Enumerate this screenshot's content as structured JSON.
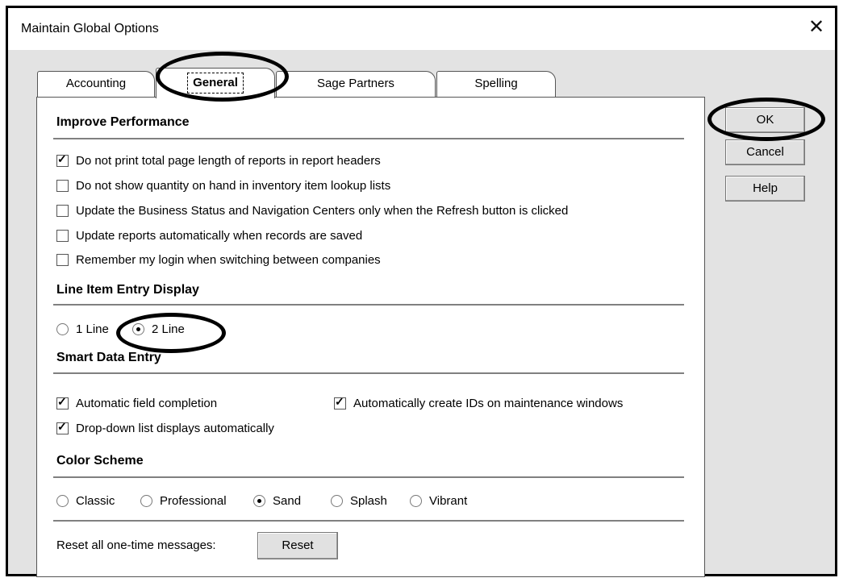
{
  "window": {
    "title": "Maintain Global Options",
    "close_glyph": "✕"
  },
  "tabs": [
    {
      "label": "Accounting",
      "active": false
    },
    {
      "label": "General",
      "active": true
    },
    {
      "label": "Sage Partners",
      "active": false
    },
    {
      "label": "Spelling",
      "active": false
    }
  ],
  "buttons": {
    "ok": "OK",
    "cancel": "Cancel",
    "help": "Help"
  },
  "improve_performance": {
    "heading": "Improve Performance",
    "options": [
      {
        "label": "Do not print total page length of reports in report headers",
        "checked": true
      },
      {
        "label": "Do not show quantity on hand in inventory item lookup lists",
        "checked": false
      },
      {
        "label": "Update the Business Status and Navigation Centers only when the Refresh button is clicked",
        "checked": false
      },
      {
        "label": "Update reports automatically when records are saved",
        "checked": false
      },
      {
        "label": "Remember my login when switching between companies",
        "checked": false
      }
    ]
  },
  "line_item": {
    "heading": "Line Item Entry Display",
    "options": [
      {
        "label": "1 Line",
        "selected": false
      },
      {
        "label": "2 Line",
        "selected": true
      }
    ]
  },
  "smart_data": {
    "heading": "Smart Data Entry",
    "options": [
      {
        "label": "Automatic field completion",
        "checked": true
      },
      {
        "label": "Automatically create IDs on maintenance windows",
        "checked": true
      },
      {
        "label": "Drop-down list displays automatically",
        "checked": true
      }
    ]
  },
  "color_scheme": {
    "heading": "Color Scheme",
    "options": [
      {
        "label": "Classic",
        "selected": false
      },
      {
        "label": "Professional",
        "selected": false
      },
      {
        "label": "Sand",
        "selected": true
      },
      {
        "label": "Splash",
        "selected": false
      },
      {
        "label": "Vibrant",
        "selected": false
      }
    ]
  },
  "reset": {
    "label": "Reset all one-time messages:",
    "button": "Reset"
  }
}
